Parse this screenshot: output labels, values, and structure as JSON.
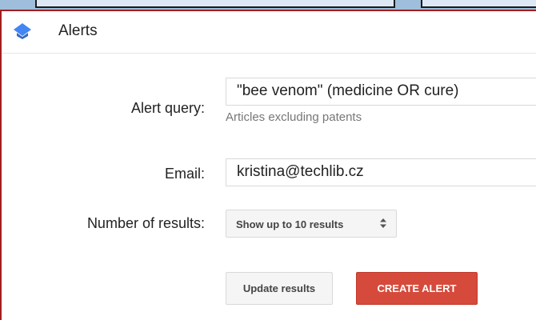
{
  "header": {
    "title": "Alerts",
    "icon": "scholar-cap-icon",
    "icon_color": "#4285f4"
  },
  "form": {
    "query_label": "Alert query:",
    "query_value": "\"bee venom\" (medicine OR cure)",
    "query_hint": "Articles excluding patents",
    "email_label": "Email:",
    "email_value": "kristina@techlib.cz",
    "results_label": "Number of results:",
    "results_selected": "Show up to 10 results"
  },
  "buttons": {
    "update_label": "Update results",
    "create_label": "CREATE ALERT"
  },
  "colors": {
    "accent_red": "#d54a3b",
    "frame_border": "#a21f1f",
    "top_strip": "#9fbedb"
  }
}
